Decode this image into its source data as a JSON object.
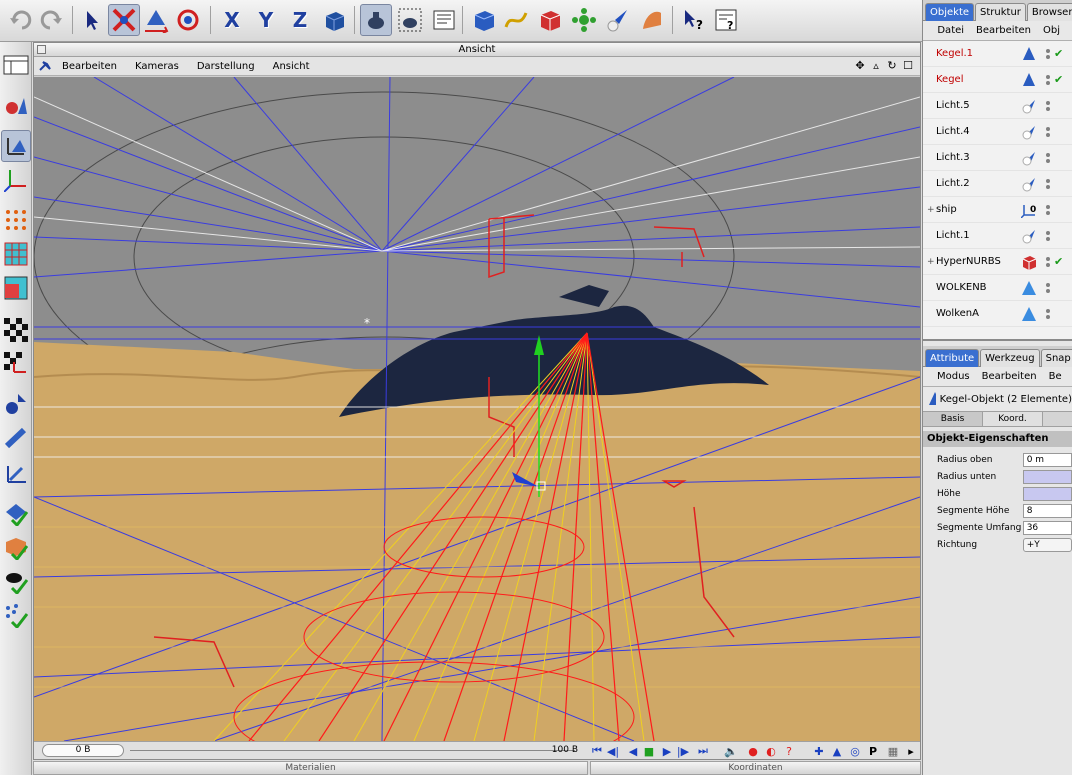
{
  "viewport": {
    "title": "Ansicht",
    "menu": [
      "Bearbeiten",
      "Kameras",
      "Darstellung",
      "Ansicht"
    ],
    "nav_icons": [
      "move-icon",
      "zoom-icon",
      "rotate-icon",
      "maximize-icon"
    ]
  },
  "toolbar": {
    "axes": [
      "X",
      "Y",
      "Z"
    ]
  },
  "timeline": {
    "current_frame": "0 B",
    "end_frame": "100 B"
  },
  "bottom": {
    "materials": "Materialien",
    "coordinates": "Koordinaten"
  },
  "objects_panel": {
    "tabs": [
      "Objekte",
      "Struktur",
      "Browser"
    ],
    "menu": [
      "Datei",
      "Bearbeiten",
      "Obj"
    ],
    "items": [
      {
        "name": "Kegel.1",
        "icon": "cone-icon",
        "active": true,
        "check": true,
        "tree": ""
      },
      {
        "name": "Kegel",
        "icon": "cone-icon",
        "active": true,
        "check": true,
        "tree": ""
      },
      {
        "name": "Licht.5",
        "icon": "light-icon",
        "active": false,
        "check": false,
        "tree": ""
      },
      {
        "name": "Licht.4",
        "icon": "light-icon",
        "active": false,
        "check": false,
        "tree": ""
      },
      {
        "name": "Licht.3",
        "icon": "light-icon",
        "active": false,
        "check": false,
        "tree": ""
      },
      {
        "name": "Licht.2",
        "icon": "light-icon",
        "active": false,
        "check": false,
        "tree": ""
      },
      {
        "name": "ship",
        "icon": "null-object-icon",
        "active": false,
        "check": false,
        "tree": "+"
      },
      {
        "name": "Licht.1",
        "icon": "light-icon",
        "active": false,
        "check": false,
        "tree": ""
      },
      {
        "name": "HyperNURBS",
        "icon": "hypernurbs-icon",
        "active": false,
        "check": true,
        "tree": "+"
      },
      {
        "name": "WOLKENB",
        "icon": "plane-icon",
        "active": false,
        "check": false,
        "tree": ""
      },
      {
        "name": "WolkenA",
        "icon": "plane-icon",
        "active": false,
        "check": false,
        "tree": ""
      }
    ]
  },
  "attributes_panel": {
    "tabs": [
      "Attribute",
      "Werkzeug",
      "Snap"
    ],
    "menu": [
      "Modus",
      "Bearbeiten",
      "Be"
    ],
    "object_title": "Kegel-Objekt (2 Elemente)",
    "subtabs": [
      "Basis",
      "Koord."
    ],
    "section": "Objekt-Eigenschaften",
    "fields": [
      {
        "label": "Radius oben",
        "value": "0 m"
      },
      {
        "label": "Radius unten",
        "value": ""
      },
      {
        "label": "Höhe",
        "value": ""
      },
      {
        "label": "Segmente Höhe",
        "value": "8"
      },
      {
        "label": "Segmente Umfang",
        "value": "36"
      },
      {
        "label": "Richtung",
        "value": "+Y"
      }
    ]
  }
}
